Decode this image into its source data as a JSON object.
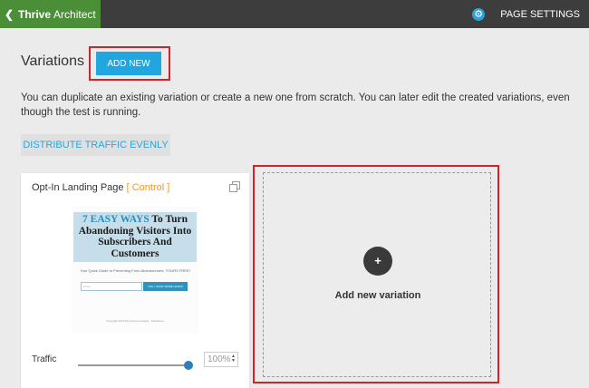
{
  "topbar": {
    "back_icon": "chevron-left-icon",
    "brand_name": "Thrive",
    "brand_sub": "Architect",
    "settings_icon": "gear-icon",
    "page_settings_label": "PAGE SETTINGS"
  },
  "header": {
    "title": "Variations",
    "add_new_label": "ADD NEW"
  },
  "description": "You can duplicate an existing variation or create a new one from scratch. You can later edit the created variations, even though the test is running.",
  "distribute_label": "DISTRIBUTE TRAFFIC EVENLY",
  "card": {
    "name": "Opt-In Landing Page",
    "control_label": "[ Control ]",
    "clone_icon": "clone-icon",
    "preview": {
      "headline_accent": "7 EASY WAYS",
      "headline_rest": " To Turn Abandoning Visitors Into Subscribers And Customers",
      "subtitle": "Your Quick Guide to Preventing Form Abandonment, YOURS FREE!",
      "input_placeholder": "Email",
      "button_label": "YES, I WANT MORE LEADS!",
      "footer": "Copyright 2016 My Great Company · Disclaimer"
    },
    "traffic_label": "Traffic",
    "traffic_value": "100%",
    "traffic_fraction": 1.0
  },
  "add_variation": {
    "plus_icon": "plus-icon",
    "label": "Add new variation"
  },
  "colors": {
    "brand_green": "#4a8e37",
    "accent_blue": "#22a6e0",
    "highlight_red": "#d3222a",
    "control_orange": "#f7941d"
  }
}
